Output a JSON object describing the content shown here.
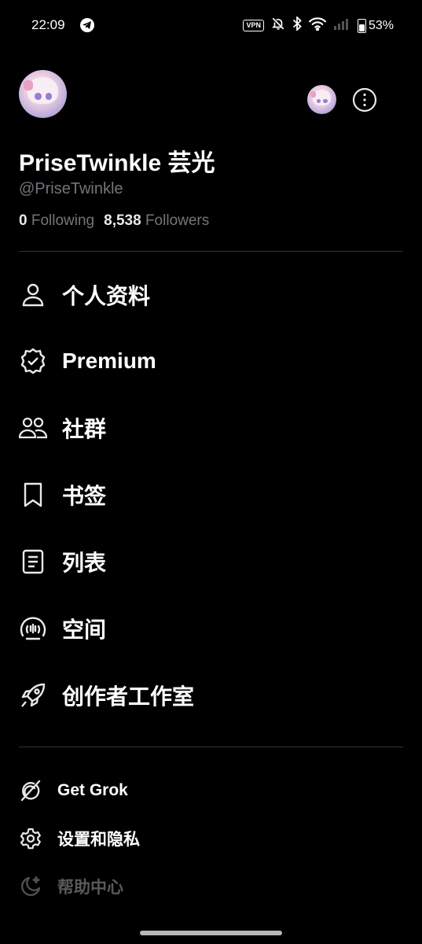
{
  "status_bar": {
    "time": "22:09",
    "vpn": "VPN",
    "battery": "53%",
    "battery_level": 0.53,
    "icons": [
      "telegram-icon",
      "vpn-icon",
      "bell-off-icon",
      "bluetooth-icon",
      "wifi-icon",
      "signal-icon",
      "battery-icon"
    ]
  },
  "profile": {
    "display_name": "PriseTwinkle 芸光",
    "handle": "@PriseTwinkle",
    "following_count": "0",
    "following_label": "Following",
    "followers_count": "8,538",
    "followers_label": "Followers"
  },
  "menu": [
    {
      "label": "个人资料",
      "icon": "person-icon"
    },
    {
      "label": "Premium",
      "icon": "verified-badge-icon"
    },
    {
      "label": "社群",
      "icon": "communities-icon"
    },
    {
      "label": "书签",
      "icon": "bookmark-icon"
    },
    {
      "label": "列表",
      "icon": "list-icon"
    },
    {
      "label": "空间",
      "icon": "spaces-icon"
    },
    {
      "label": "创作者工作室",
      "icon": "rocket-icon"
    }
  ],
  "secondary_menu": [
    {
      "label": "Get Grok",
      "icon": "grok-icon"
    },
    {
      "label": "设置和隐私",
      "icon": "gear-icon"
    },
    {
      "label": "帮助中心",
      "icon": "moon-icon"
    }
  ],
  "colors": {
    "background": "#000000",
    "text": "#e7e9ea",
    "muted": "#71767b",
    "divider": "#2f3336"
  }
}
